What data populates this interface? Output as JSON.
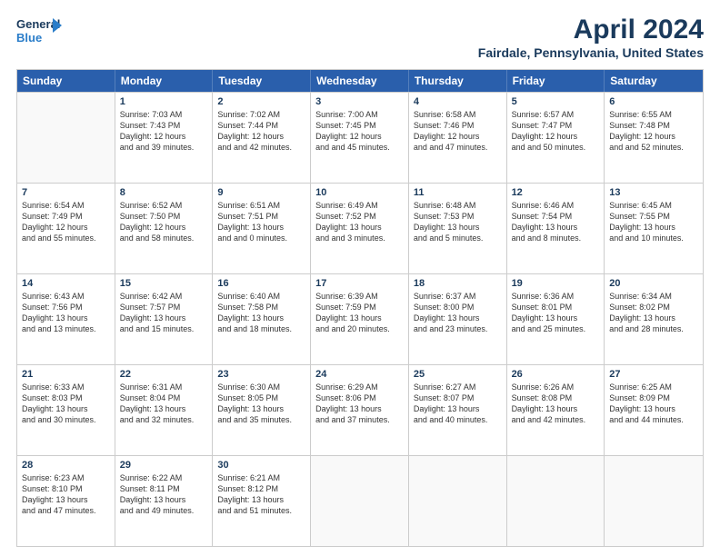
{
  "header": {
    "logo_line1": "General",
    "logo_line2": "Blue",
    "title": "April 2024",
    "subtitle": "Fairdale, Pennsylvania, United States"
  },
  "calendar": {
    "days_of_week": [
      "Sunday",
      "Monday",
      "Tuesday",
      "Wednesday",
      "Thursday",
      "Friday",
      "Saturday"
    ],
    "rows": [
      [
        {
          "day": "",
          "sunrise": "",
          "sunset": "",
          "daylight": ""
        },
        {
          "day": "1",
          "sunrise": "Sunrise: 7:03 AM",
          "sunset": "Sunset: 7:43 PM",
          "daylight": "Daylight: 12 hours and 39 minutes."
        },
        {
          "day": "2",
          "sunrise": "Sunrise: 7:02 AM",
          "sunset": "Sunset: 7:44 PM",
          "daylight": "Daylight: 12 hours and 42 minutes."
        },
        {
          "day": "3",
          "sunrise": "Sunrise: 7:00 AM",
          "sunset": "Sunset: 7:45 PM",
          "daylight": "Daylight: 12 hours and 45 minutes."
        },
        {
          "day": "4",
          "sunrise": "Sunrise: 6:58 AM",
          "sunset": "Sunset: 7:46 PM",
          "daylight": "Daylight: 12 hours and 47 minutes."
        },
        {
          "day": "5",
          "sunrise": "Sunrise: 6:57 AM",
          "sunset": "Sunset: 7:47 PM",
          "daylight": "Daylight: 12 hours and 50 minutes."
        },
        {
          "day": "6",
          "sunrise": "Sunrise: 6:55 AM",
          "sunset": "Sunset: 7:48 PM",
          "daylight": "Daylight: 12 hours and 52 minutes."
        }
      ],
      [
        {
          "day": "7",
          "sunrise": "Sunrise: 6:54 AM",
          "sunset": "Sunset: 7:49 PM",
          "daylight": "Daylight: 12 hours and 55 minutes."
        },
        {
          "day": "8",
          "sunrise": "Sunrise: 6:52 AM",
          "sunset": "Sunset: 7:50 PM",
          "daylight": "Daylight: 12 hours and 58 minutes."
        },
        {
          "day": "9",
          "sunrise": "Sunrise: 6:51 AM",
          "sunset": "Sunset: 7:51 PM",
          "daylight": "Daylight: 13 hours and 0 minutes."
        },
        {
          "day": "10",
          "sunrise": "Sunrise: 6:49 AM",
          "sunset": "Sunset: 7:52 PM",
          "daylight": "Daylight: 13 hours and 3 minutes."
        },
        {
          "day": "11",
          "sunrise": "Sunrise: 6:48 AM",
          "sunset": "Sunset: 7:53 PM",
          "daylight": "Daylight: 13 hours and 5 minutes."
        },
        {
          "day": "12",
          "sunrise": "Sunrise: 6:46 AM",
          "sunset": "Sunset: 7:54 PM",
          "daylight": "Daylight: 13 hours and 8 minutes."
        },
        {
          "day": "13",
          "sunrise": "Sunrise: 6:45 AM",
          "sunset": "Sunset: 7:55 PM",
          "daylight": "Daylight: 13 hours and 10 minutes."
        }
      ],
      [
        {
          "day": "14",
          "sunrise": "Sunrise: 6:43 AM",
          "sunset": "Sunset: 7:56 PM",
          "daylight": "Daylight: 13 hours and 13 minutes."
        },
        {
          "day": "15",
          "sunrise": "Sunrise: 6:42 AM",
          "sunset": "Sunset: 7:57 PM",
          "daylight": "Daylight: 13 hours and 15 minutes."
        },
        {
          "day": "16",
          "sunrise": "Sunrise: 6:40 AM",
          "sunset": "Sunset: 7:58 PM",
          "daylight": "Daylight: 13 hours and 18 minutes."
        },
        {
          "day": "17",
          "sunrise": "Sunrise: 6:39 AM",
          "sunset": "Sunset: 7:59 PM",
          "daylight": "Daylight: 13 hours and 20 minutes."
        },
        {
          "day": "18",
          "sunrise": "Sunrise: 6:37 AM",
          "sunset": "Sunset: 8:00 PM",
          "daylight": "Daylight: 13 hours and 23 minutes."
        },
        {
          "day": "19",
          "sunrise": "Sunrise: 6:36 AM",
          "sunset": "Sunset: 8:01 PM",
          "daylight": "Daylight: 13 hours and 25 minutes."
        },
        {
          "day": "20",
          "sunrise": "Sunrise: 6:34 AM",
          "sunset": "Sunset: 8:02 PM",
          "daylight": "Daylight: 13 hours and 28 minutes."
        }
      ],
      [
        {
          "day": "21",
          "sunrise": "Sunrise: 6:33 AM",
          "sunset": "Sunset: 8:03 PM",
          "daylight": "Daylight: 13 hours and 30 minutes."
        },
        {
          "day": "22",
          "sunrise": "Sunrise: 6:31 AM",
          "sunset": "Sunset: 8:04 PM",
          "daylight": "Daylight: 13 hours and 32 minutes."
        },
        {
          "day": "23",
          "sunrise": "Sunrise: 6:30 AM",
          "sunset": "Sunset: 8:05 PM",
          "daylight": "Daylight: 13 hours and 35 minutes."
        },
        {
          "day": "24",
          "sunrise": "Sunrise: 6:29 AM",
          "sunset": "Sunset: 8:06 PM",
          "daylight": "Daylight: 13 hours and 37 minutes."
        },
        {
          "day": "25",
          "sunrise": "Sunrise: 6:27 AM",
          "sunset": "Sunset: 8:07 PM",
          "daylight": "Daylight: 13 hours and 40 minutes."
        },
        {
          "day": "26",
          "sunrise": "Sunrise: 6:26 AM",
          "sunset": "Sunset: 8:08 PM",
          "daylight": "Daylight: 13 hours and 42 minutes."
        },
        {
          "day": "27",
          "sunrise": "Sunrise: 6:25 AM",
          "sunset": "Sunset: 8:09 PM",
          "daylight": "Daylight: 13 hours and 44 minutes."
        }
      ],
      [
        {
          "day": "28",
          "sunrise": "Sunrise: 6:23 AM",
          "sunset": "Sunset: 8:10 PM",
          "daylight": "Daylight: 13 hours and 47 minutes."
        },
        {
          "day": "29",
          "sunrise": "Sunrise: 6:22 AM",
          "sunset": "Sunset: 8:11 PM",
          "daylight": "Daylight: 13 hours and 49 minutes."
        },
        {
          "day": "30",
          "sunrise": "Sunrise: 6:21 AM",
          "sunset": "Sunset: 8:12 PM",
          "daylight": "Daylight: 13 hours and 51 minutes."
        },
        {
          "day": "",
          "sunrise": "",
          "sunset": "",
          "daylight": ""
        },
        {
          "day": "",
          "sunrise": "",
          "sunset": "",
          "daylight": ""
        },
        {
          "day": "",
          "sunrise": "",
          "sunset": "",
          "daylight": ""
        },
        {
          "day": "",
          "sunrise": "",
          "sunset": "",
          "daylight": ""
        }
      ]
    ]
  }
}
